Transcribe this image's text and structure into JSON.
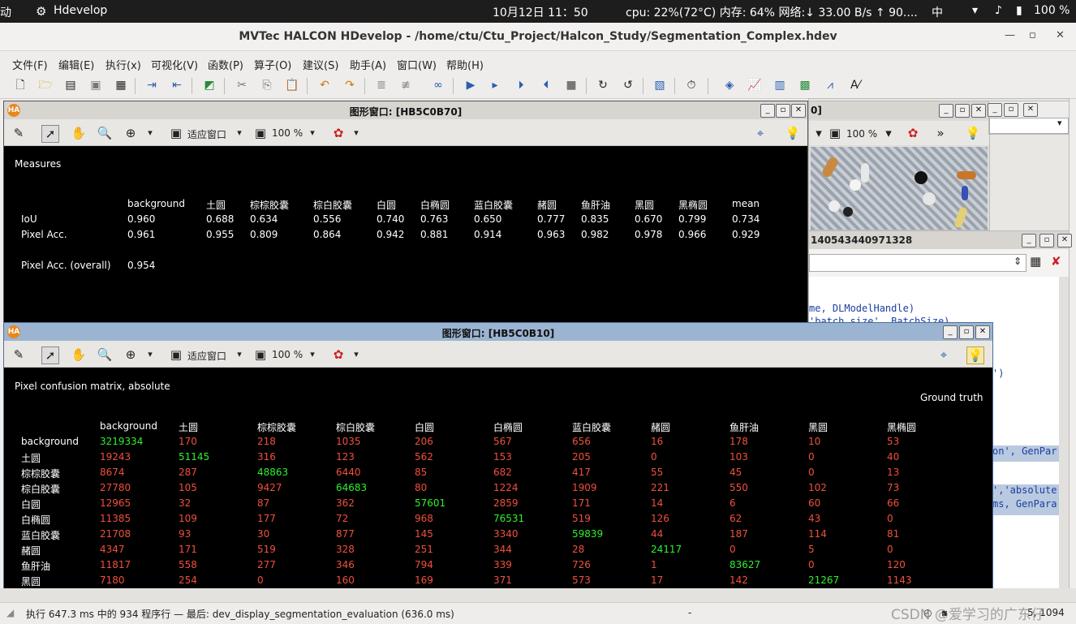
{
  "system_bar": {
    "left_label": "动",
    "app_name": "Hdevelop",
    "datetime": "10月12日  11：50",
    "stats": "cpu: 22%(72°C) 内存: 64% 网络:↓  33.00 B/s ↑  90....",
    "input_method": "中",
    "battery": "100 %"
  },
  "window": {
    "title": "MVTec HALCON HDevelop - /home/ctu/Ctu_Project/Halcon_Study/Segmentation_Complex.hdev"
  },
  "menu": [
    "文件(F)",
    "编辑(E)",
    "执行(x)",
    "可视化(V)",
    "函数(P)",
    "算子(O)",
    "建议(S)",
    "助手(A)",
    "窗口(W)",
    "帮助(H)"
  ],
  "graphics_window_1": {
    "title": "图形窗口: [HB5C0B70]",
    "fit_label": "适应窗口",
    "zoom": "100 %",
    "heading": "Measures",
    "columns": [
      "background",
      "土圆",
      "棕棕胶囊",
      "棕白胶囊",
      "白圆",
      "白椭圆",
      "蓝白胶囊",
      "赭圆",
      "鱼肝油",
      "黑圆",
      "黑椭圆",
      "mean"
    ],
    "rows": [
      {
        "label": "IoU",
        "values": [
          "0.960",
          "0.688",
          "0.634",
          "0.556",
          "0.740",
          "0.763",
          "0.650",
          "0.777",
          "0.835",
          "0.670",
          "0.799",
          "0.734"
        ]
      },
      {
        "label": "Pixel Acc.",
        "values": [
          "0.961",
          "0.955",
          "0.809",
          "0.864",
          "0.942",
          "0.881",
          "0.914",
          "0.963",
          "0.982",
          "0.978",
          "0.966",
          "0.929"
        ]
      }
    ],
    "overall_label": "Pixel Acc. (overall)",
    "overall_value": "0.954"
  },
  "graphics_window_2": {
    "title": "图形窗口: [HB5C0B10]",
    "fit_label": "适应窗口",
    "zoom": "100 %",
    "heading": "Pixel confusion matrix, absolute",
    "ground_truth": "Ground truth",
    "columns": [
      "background",
      "土圆",
      "棕棕胶囊",
      "棕白胶囊",
      "白圆",
      "白椭圆",
      "蓝白胶囊",
      "赭圆",
      "鱼肝油",
      "黑圆",
      "黑椭圆"
    ],
    "rows": [
      {
        "label": "background",
        "values": [
          "3219334",
          "170",
          "218",
          "1035",
          "206",
          "567",
          "656",
          "16",
          "178",
          "10",
          "53"
        ]
      },
      {
        "label": "土圆",
        "values": [
          "19243",
          "51145",
          "316",
          "123",
          "562",
          "153",
          "205",
          "0",
          "103",
          "0",
          "40"
        ]
      },
      {
        "label": "棕棕胶囊",
        "values": [
          "8674",
          "287",
          "48863",
          "6440",
          "85",
          "682",
          "417",
          "55",
          "45",
          "0",
          "13"
        ]
      },
      {
        "label": "棕白胶囊",
        "values": [
          "27780",
          "105",
          "9427",
          "64683",
          "80",
          "1224",
          "1909",
          "221",
          "550",
          "102",
          "73"
        ]
      },
      {
        "label": "白圆",
        "values": [
          "12965",
          "32",
          "87",
          "362",
          "57601",
          "2859",
          "171",
          "14",
          "6",
          "60",
          "66"
        ]
      },
      {
        "label": "白椭圆",
        "values": [
          "11385",
          "109",
          "177",
          "72",
          "968",
          "76531",
          "519",
          "126",
          "62",
          "43",
          "0"
        ]
      },
      {
        "label": "蓝白胶囊",
        "values": [
          "21708",
          "93",
          "30",
          "877",
          "145",
          "3340",
          "59839",
          "44",
          "187",
          "114",
          "81"
        ]
      },
      {
        "label": "赭圆",
        "values": [
          "4347",
          "171",
          "519",
          "328",
          "251",
          "344",
          "28",
          "24117",
          "0",
          "5",
          "0"
        ]
      },
      {
        "label": "鱼肝油",
        "values": [
          "11817",
          "558",
          "277",
          "346",
          "794",
          "339",
          "726",
          "1",
          "83627",
          "0",
          "120"
        ]
      },
      {
        "label": "黑圆",
        "values": [
          "7180",
          "254",
          "0",
          "160",
          "169",
          "371",
          "573",
          "17",
          "142",
          "21267",
          "1143"
        ]
      }
    ]
  },
  "right_panels": {
    "image_window_title_fragment": "0]",
    "image_window_zoom": "100 %",
    "variable_window_title": "140543440971328",
    "code_lines": [
      "me, DLModelHandle)",
      "'batch_size', BatchSize)",
      "')",
      "on', GenPar",
      "','absolute",
      "ms, GenPara"
    ]
  },
  "status": {
    "text": "执行 647.3 ms 中的 934 程序行 — 最后: dev_display_segmentation_evaluation (636.0 ms)",
    "dash": "-",
    "position": "5, 1094",
    "watermark": "CSDN @爱学习的广东仔"
  }
}
